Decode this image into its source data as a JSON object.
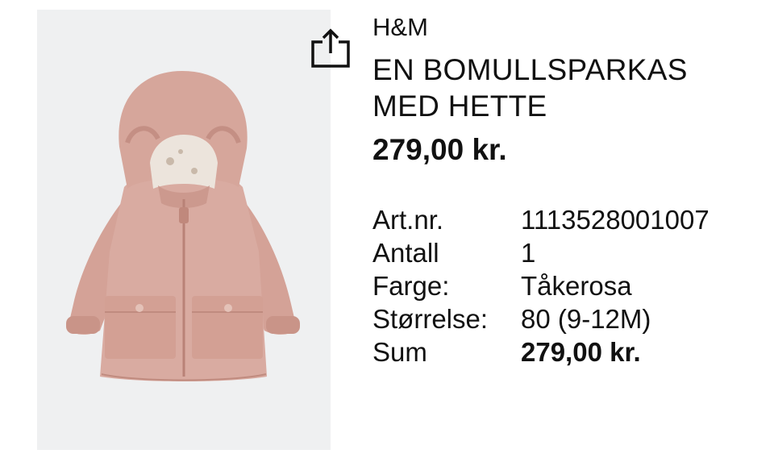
{
  "product": {
    "brand": "H&M",
    "title_lines": [
      "EN BOMULLSPARKAS",
      "MED HETTE"
    ],
    "price": "279,00 kr.",
    "image_icon": "coat-image",
    "share_icon": "share-icon"
  },
  "specs": [
    {
      "label": "Art.nr.",
      "value": "1113528001007"
    },
    {
      "label": "Antall",
      "value": "1"
    },
    {
      "label": "Farge:",
      "value": "Tåkerosa"
    },
    {
      "label": "Størrelse:",
      "value": "80 (9-12M)"
    },
    {
      "label": "Sum",
      "value": "279,00 kr."
    }
  ],
  "colors": {
    "image_background": "#eff0f1",
    "coat": "#d9aba1",
    "text": "#111111"
  }
}
